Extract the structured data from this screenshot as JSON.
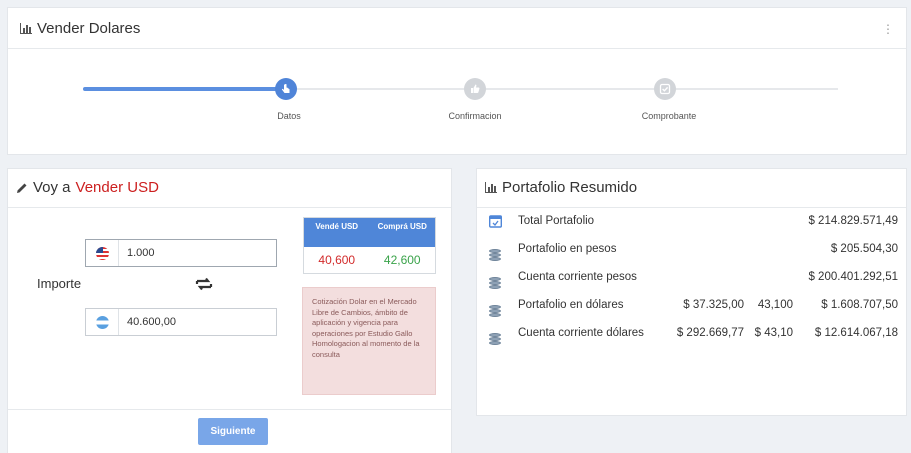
{
  "top_panel": {
    "title": "Vender Dolares",
    "menu": "⋮",
    "steps": [
      {
        "label": "Datos",
        "state": "active",
        "icon": "hand-pointer-icon"
      },
      {
        "label": "Confirmacion",
        "state": "pending",
        "icon": "thumbs-up-icon"
      },
      {
        "label": "Comprobante",
        "state": "pending",
        "icon": "check-square-icon"
      }
    ],
    "progress_fraction": 0.27
  },
  "sell_panel": {
    "title_prefix": "Voy a",
    "title_highlight": "Vender USD",
    "importe_label": "Importe",
    "usd_field": {
      "value": "1.000",
      "flag": "usa-flag-icon"
    },
    "ars_field": {
      "value": "40.600,00",
      "flag": "argentina-flag-icon"
    },
    "quote": {
      "sell_header": "Vendé USD",
      "buy_header": "Comprá USD",
      "sell_value": "40,600",
      "buy_value": "42,600"
    },
    "note": "Cotización Dolar en el Mercado Libre de Cambios, ámbito de aplicación y vigencia para operaciones por Estudio Gallo Homologacion al momento de la consulta",
    "next_button": "Siguiente"
  },
  "portfolio_panel": {
    "title": "Portafolio Resumido",
    "rows": [
      {
        "icon": "calendar-icon",
        "label": "Total Portafolio",
        "col1": "",
        "col2": "",
        "amount": "$ 214.829.571,49"
      },
      {
        "icon": "database-icon",
        "label": "Portafolio en pesos",
        "col1": "",
        "col2": "",
        "amount": "$ 205.504,30"
      },
      {
        "icon": "database-icon",
        "label": "Cuenta corriente pesos",
        "col1": "",
        "col2": "",
        "amount": "$ 200.401.292,51"
      },
      {
        "icon": "database-icon",
        "label": "Portafolio en dólares",
        "col1": "$ 37.325,00",
        "col2": "43,100",
        "amount": "$ 1.608.707,50"
      },
      {
        "icon": "database-icon",
        "label": "Cuenta corriente dólares",
        "col1": "$ 292.669,77",
        "col2": "$ 43,10",
        "amount": "$ 12.614.067,18"
      }
    ]
  },
  "colors": {
    "accent": "#4f84d8",
    "sell": "#d22b2b",
    "buy": "#3aa34a",
    "note_bg": "#f3dede"
  }
}
